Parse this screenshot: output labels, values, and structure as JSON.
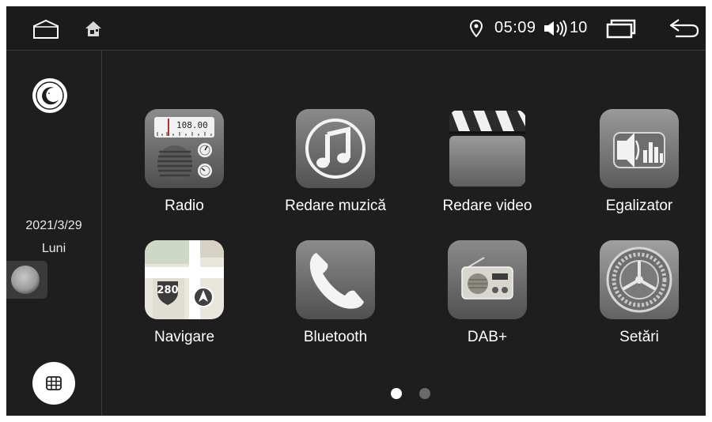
{
  "statusbar": {
    "icons": {
      "home": "home-outline-icon",
      "app": "house-app-icon",
      "location": "location-pin-icon",
      "volume": "speaker-volume-icon",
      "recent": "recent-apps-icon",
      "back": "back-arrow-icon"
    },
    "time": "05:09",
    "volume_level": "10"
  },
  "sidebar": {
    "night_icon": "moon-stars-icon",
    "date": "2021/3/29",
    "weekday": "Luni",
    "float_icon": "floating-ball-icon",
    "apps_icon": "grid-icon"
  },
  "apps": [
    {
      "label": "Radio",
      "icon": "radio-icon",
      "freq": "108.00"
    },
    {
      "label": "Redare muzică",
      "icon": "music-note-icon"
    },
    {
      "label": "Redare video",
      "icon": "clapperboard-icon"
    },
    {
      "label": "Egalizator",
      "icon": "equalizer-speaker-icon"
    },
    {
      "label": "Navigare",
      "icon": "map-navigation-icon",
      "road": "280"
    },
    {
      "label": "Bluetooth",
      "icon": "phone-handset-icon"
    },
    {
      "label": "DAB+",
      "icon": "portable-radio-icon"
    },
    {
      "label": "Setări",
      "icon": "settings-gear-icon"
    }
  ],
  "pager": {
    "current": 1,
    "total": 2
  },
  "colors": {
    "screen_bg": "#1e1e1e",
    "statusbar_bg": "#1b1b1b",
    "text": "#ffffff",
    "dot_active": "#ffffff",
    "dot_inactive": "#6a6a6a"
  }
}
